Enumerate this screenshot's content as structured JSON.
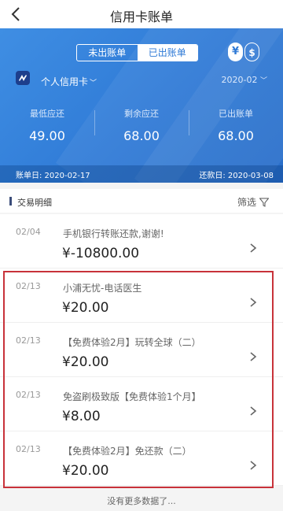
{
  "nav": {
    "title": "信用卡账单"
  },
  "hero": {
    "tabs": [
      {
        "label": "未出账单",
        "selected": false
      },
      {
        "label": "已出账单",
        "selected": true
      }
    ],
    "currency": {
      "yen": "¥",
      "usd": "$"
    },
    "card_name": "个人信用卡",
    "period": "2020-02",
    "stats": [
      {
        "label": "最低应还",
        "value": "49.00"
      },
      {
        "label": "剩余应还",
        "value": "68.00"
      },
      {
        "label": "已出账单",
        "value": "68.00"
      }
    ],
    "bill_date": "账单日: 2020-02-17",
    "due_date": "还款日: 2020-03-08"
  },
  "section": {
    "title": "交易明细",
    "filter_label": "筛选"
  },
  "transactions": [
    {
      "date": "02/04",
      "desc": "手机银行转账还款,谢谢!",
      "amount": "¥-10800.00"
    },
    {
      "date": "02/13",
      "desc": "小浦无忧-电话医生",
      "amount": "¥20.00"
    },
    {
      "date": "02/13",
      "desc": "【免费体验2月】玩转全球（二）",
      "amount": "¥20.00"
    },
    {
      "date": "02/13",
      "desc": "免盗刷极致版【免费体验1个月】",
      "amount": "¥8.00"
    },
    {
      "date": "02/13",
      "desc": "【免费体验2月】免还款（二）",
      "amount": "¥20.00"
    }
  ],
  "footer": {
    "note": "没有更多数据了..."
  },
  "colors": {
    "primary": "#2f7ad6",
    "highlight": "#c8323a"
  }
}
